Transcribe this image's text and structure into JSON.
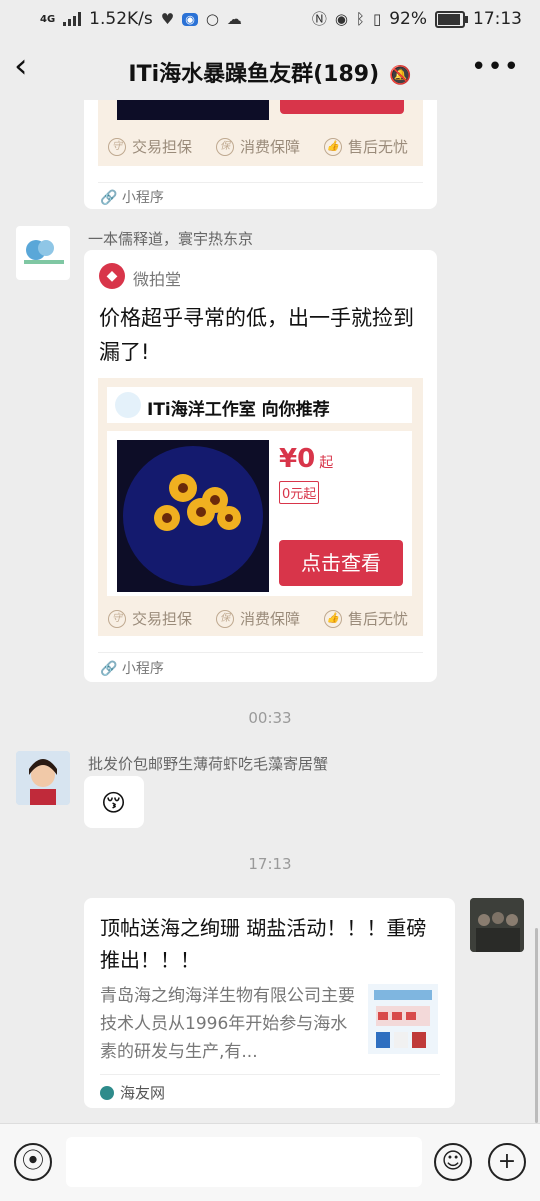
{
  "status": {
    "network": "4G",
    "speed": "1.52K/s",
    "battery": "92%",
    "time": "17:13"
  },
  "header": {
    "title": "ITi海水暴躁鱼友群(189)"
  },
  "msg1": {
    "guarantees": [
      "交易担保",
      "消费保障",
      "售后无忧"
    ],
    "mini_label": "小程序"
  },
  "msg2": {
    "sender": "一本儒释道，寰宇热东京",
    "app_name": "微拍堂",
    "text": "价格超乎寻常的低，出一手就捡到漏了!",
    "shop": "ITi海洋工作室 向你推荐",
    "price": "¥0",
    "price_suffix": "起",
    "price_tag": "0元起",
    "cta": "点击查看",
    "guarantees": [
      "交易担保",
      "消费保障",
      "售后无忧"
    ],
    "mini_label": "小程序"
  },
  "time1": "00:33",
  "msg3": {
    "sender": "批发价包邮野生薄荷虾吃毛藻寄居蟹",
    "emoji": "😚"
  },
  "time2": "17:13",
  "msg4": {
    "title": "顶帖送海之绚珊 瑚盐活动！！！重磅推出！！！",
    "desc": "青岛海之绚海洋生物有限公司主要技术人员从1996年开始参与海水素的研发与生产,有...",
    "source": "海友网"
  }
}
